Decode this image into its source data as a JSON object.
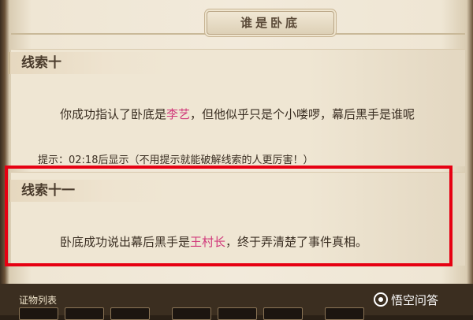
{
  "header": {
    "title": "谁是卧底"
  },
  "clue10": {
    "title": "线索十",
    "text_before": "你成功指认了卧底是",
    "highlight": "李艺",
    "text_after": "，但他似乎只是个小喽啰，幕后黑手是谁呢"
  },
  "hint": {
    "text": "提示：02:18后显示（不用提示就能破解线索的人更厉害！）"
  },
  "clue11": {
    "title": "线索十一",
    "text_before": "卧底成功说出幕后黑手是",
    "highlight": "王村长",
    "text_after": "，终于弄清楚了事件真相。"
  },
  "evidence": {
    "label": "证物列表"
  },
  "watermark": {
    "text": "悟空问答"
  },
  "colors": {
    "highlight": "#d0387a",
    "annotation_box": "#e60012"
  }
}
